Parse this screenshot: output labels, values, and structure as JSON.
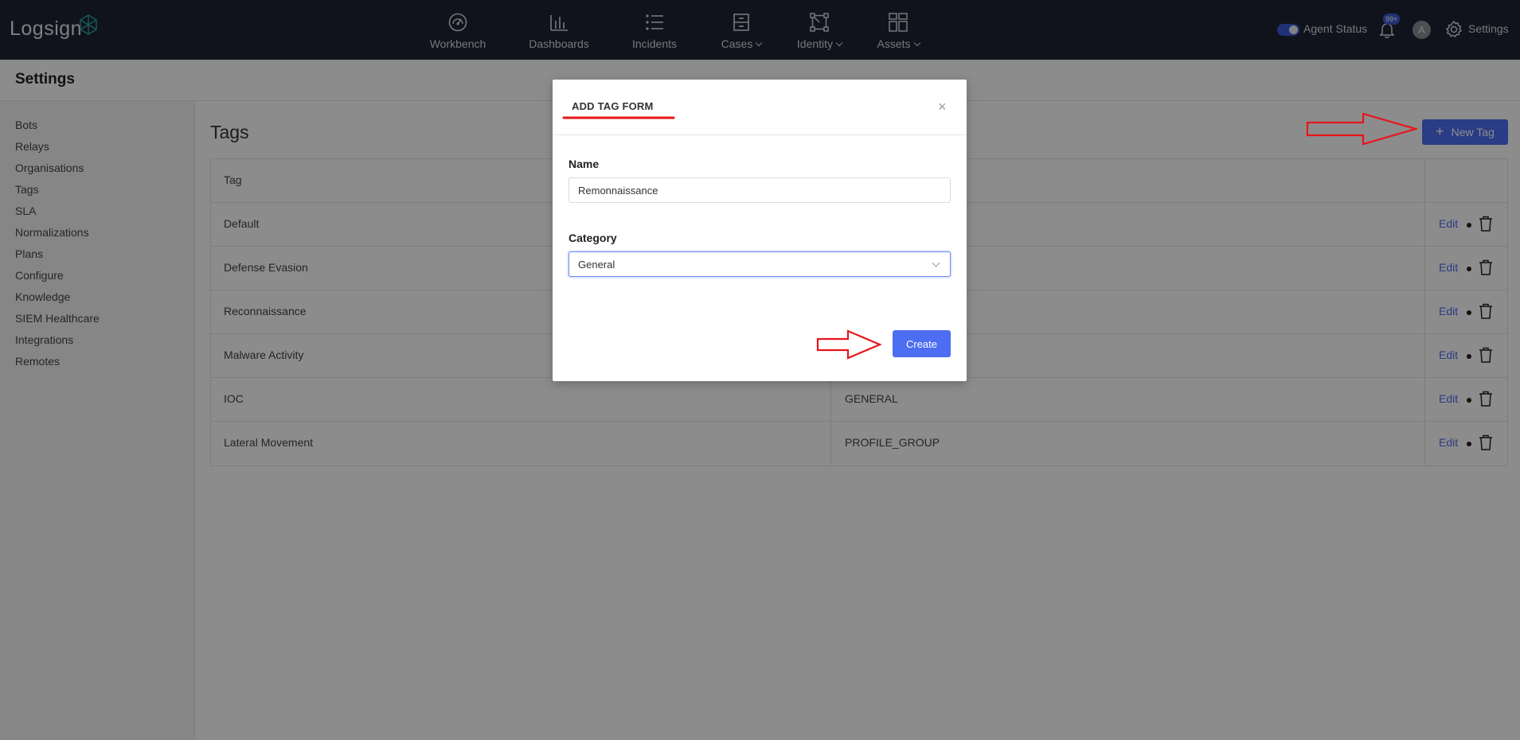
{
  "topbar": {
    "logo": "Logsign",
    "nav": [
      {
        "label": "Workbench",
        "icon": "gauge-icon",
        "dropdown": false
      },
      {
        "label": "Dashboards",
        "icon": "bar-chart-icon",
        "dropdown": false
      },
      {
        "label": "Incidents",
        "icon": "list-icon",
        "dropdown": false
      },
      {
        "label": "Cases",
        "icon": "cabinet-icon",
        "dropdown": true
      },
      {
        "label": "Identity",
        "icon": "network-icon",
        "dropdown": true
      },
      {
        "label": "Assets",
        "icon": "grid-icon",
        "dropdown": true
      }
    ],
    "agent_status_label": "Agent Status",
    "notifications_badge": "99+",
    "avatar_initial": "A",
    "settings_label": "Settings"
  },
  "page": {
    "title": "Settings"
  },
  "sidebar": {
    "items": [
      {
        "label": "Bots"
      },
      {
        "label": "Relays"
      },
      {
        "label": "Organisations"
      },
      {
        "label": "Tags"
      },
      {
        "label": "SLA"
      },
      {
        "label": "Normalizations"
      },
      {
        "label": "Plans"
      },
      {
        "label": "Configure"
      },
      {
        "label": "Knowledge"
      },
      {
        "label": "SIEM Healthcare"
      },
      {
        "label": "Integrations"
      },
      {
        "label": "Remotes"
      }
    ]
  },
  "tags": {
    "title": "Tags",
    "new_button": "New Tag",
    "new_button_icon": "plus-icon",
    "columns": [
      "Tag",
      "",
      ""
    ],
    "edit_label": "Edit",
    "rows": [
      {
        "tag": "Default",
        "category": ""
      },
      {
        "tag": "Defense Evasion",
        "category": ""
      },
      {
        "tag": "Reconnaissance",
        "category": ""
      },
      {
        "tag": "Malware Activity",
        "category": ""
      },
      {
        "tag": "IOC",
        "category": "GENERAL"
      },
      {
        "tag": "Lateral Movement",
        "category": "PROFILE_GROUP"
      }
    ]
  },
  "modal": {
    "title": "ADD TAG FORM",
    "close_symbol": "×",
    "name_label": "Name",
    "name_value": "Remonnaissance",
    "category_label": "Category",
    "category_value": "General",
    "create_button": "Create"
  },
  "colors": {
    "topbar": "#1f2434",
    "accent": "#4d6df3",
    "annotation": "#e8141b"
  }
}
